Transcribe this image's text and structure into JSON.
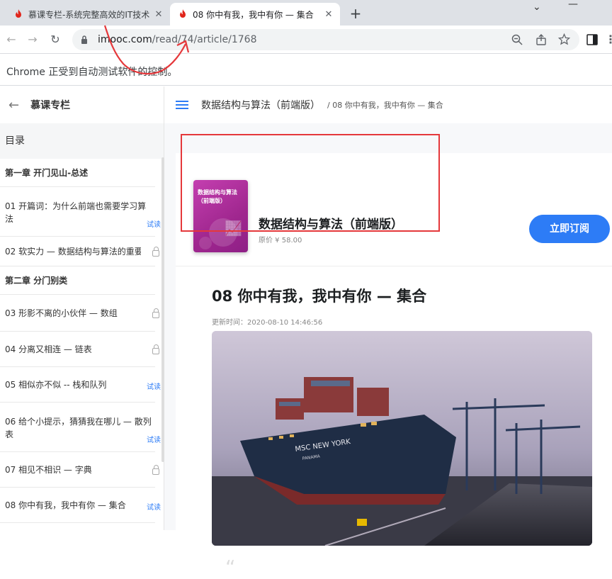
{
  "browser": {
    "tabs": [
      {
        "title": "慕课专栏-系统完整高效的IT技术",
        "active": false
      },
      {
        "title": "08 你中有我，我中有你 — 集合",
        "active": true
      }
    ],
    "new_tab_label": "+",
    "url_host": "imooc.com",
    "url_path": "/read/74/article/1768",
    "infobar_text": "Chrome 正受到自动测试软件的控制。"
  },
  "sidebar": {
    "back_label": "←",
    "title": "慕课专栏",
    "toc_label": "目录",
    "items": [
      {
        "text": "第一章 开门见山-总述",
        "type": "chapter"
      },
      {
        "text": "01 开篇词：为什么前端也需要学习算法",
        "type": "article",
        "badge": "试读"
      },
      {
        "text": "02 软实力 — 数据结构与算法的重要",
        "type": "article",
        "badge": "lock"
      },
      {
        "text": "第二章 分门别类",
        "type": "chapter"
      },
      {
        "text": "03 形影不离的小伙伴 — 数组",
        "type": "article",
        "badge": "lock"
      },
      {
        "text": "04 分离又相连 — 链表",
        "type": "article",
        "badge": "lock"
      },
      {
        "text": "05 相似亦不似 -- 栈和队列",
        "type": "article",
        "badge": "试读"
      },
      {
        "text": "06 给个小提示，猜猜我在哪儿 — 散列表",
        "type": "article",
        "badge": "试读"
      },
      {
        "text": "07 相见不相识 — 字典",
        "type": "article",
        "badge": "lock"
      },
      {
        "text": "08 你中有我，我中有你 — 集合",
        "type": "article",
        "badge": "试读"
      }
    ]
  },
  "header": {
    "column_title": "数据结构与算法（前端版）",
    "crumb": "/ 08 你中有我，我中有你 — 集合"
  },
  "course_card": {
    "cover_text": "数据结构与算法（前端版）",
    "name": "数据结构与算法（前端版）",
    "price": "原价 ¥ 58.00",
    "subscribe_label": "立即订阅"
  },
  "article": {
    "title": "08 你中有我，我中有你 — 集合",
    "updated": "更新时间：2020-08-10 14:46:56",
    "hero_ship_text": "MSC NEW YORK",
    "hero_ship_sub": "PANAMA",
    "quote_mark": "“"
  },
  "colors": {
    "accent": "#2d7cf6",
    "highlight_box": "#e5383b"
  }
}
